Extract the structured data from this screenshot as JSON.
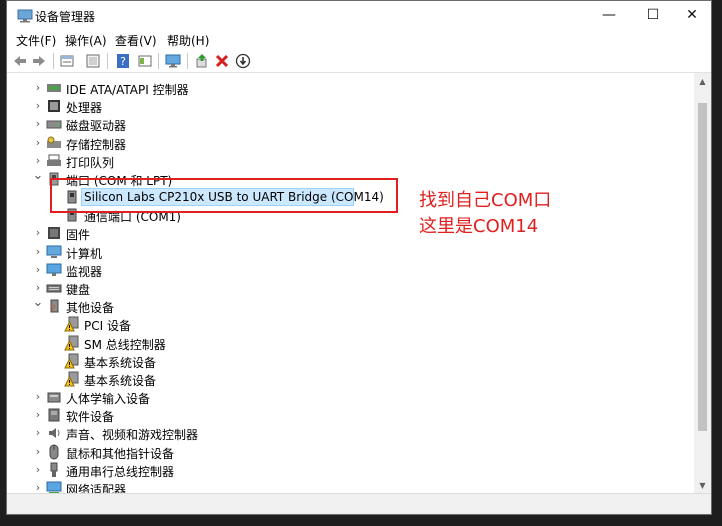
{
  "window": {
    "title": "设备管理器",
    "minimize_glyph": "—",
    "maximize_glyph": "☐",
    "close_glyph": "✕"
  },
  "menu": [
    "文件(F)",
    "操作(A)",
    "查看(V)",
    "帮助(H)"
  ],
  "toolbar": {
    "icons": [
      "back-arrow-icon",
      "forward-arrow-icon",
      "properties-icon",
      "scan-icon",
      "help-icon",
      "details-icon",
      "monitor-icon",
      "update-driver-icon",
      "uninstall-icon",
      "disable-icon"
    ]
  },
  "tree": {
    "items": [
      {
        "label": "IDE ATA/ATAPI 控制器",
        "expanded": false,
        "icon": "ide-controller-icon"
      },
      {
        "label": "处理器",
        "expanded": false,
        "icon": "processor-icon"
      },
      {
        "label": "磁盘驱动器",
        "expanded": false,
        "icon": "disk-drive-icon"
      },
      {
        "label": "存储控制器",
        "expanded": false,
        "icon": "storage-controller-icon"
      },
      {
        "label": "打印队列",
        "expanded": false,
        "icon": "printer-icon"
      },
      {
        "label": "端口 (COM 和 LPT)",
        "expanded": true,
        "icon": "port-icon"
      },
      {
        "label": "Silicon Labs CP210x USB to UART Bridge (COM14)",
        "child": true,
        "selected": true,
        "icon": "serial-port-icon"
      },
      {
        "label": "通信端口 (COM1)",
        "child": true,
        "icon": "serial-port-icon"
      },
      {
        "label": "固件",
        "expanded": false,
        "icon": "firmware-icon"
      },
      {
        "label": "计算机",
        "expanded": false,
        "icon": "computer-icon"
      },
      {
        "label": "监视器",
        "expanded": false,
        "icon": "monitor-icon"
      },
      {
        "label": "键盘",
        "expanded": false,
        "icon": "keyboard-icon"
      },
      {
        "label": "其他设备",
        "expanded": true,
        "icon": "other-device-icon"
      },
      {
        "label": "PCI 设备",
        "child": true,
        "icon": "warning-device-icon"
      },
      {
        "label": "SM 总线控制器",
        "child": true,
        "icon": "warning-device-icon"
      },
      {
        "label": "基本系统设备",
        "child": true,
        "icon": "warning-device-icon"
      },
      {
        "label": "基本系统设备",
        "child": true,
        "icon": "warning-device-icon"
      },
      {
        "label": "人体学输入设备",
        "expanded": false,
        "icon": "hid-icon"
      },
      {
        "label": "软件设备",
        "expanded": false,
        "icon": "software-device-icon"
      },
      {
        "label": "声音、视频和游戏控制器",
        "expanded": false,
        "icon": "sound-icon"
      },
      {
        "label": "鼠标和其他指针设备",
        "expanded": false,
        "icon": "mouse-icon"
      },
      {
        "label": "通用串行总线控制器",
        "expanded": false,
        "icon": "usb-icon"
      },
      {
        "label": "网络适配器",
        "expanded": false,
        "icon": "network-adapter-icon"
      }
    ]
  },
  "annotation": {
    "line1": "找到自己COM口",
    "line2": "这里是COM14",
    "color": "#e0201e"
  },
  "colors": {
    "selection": "#cce8ff",
    "accent_red": "#e0201e"
  }
}
